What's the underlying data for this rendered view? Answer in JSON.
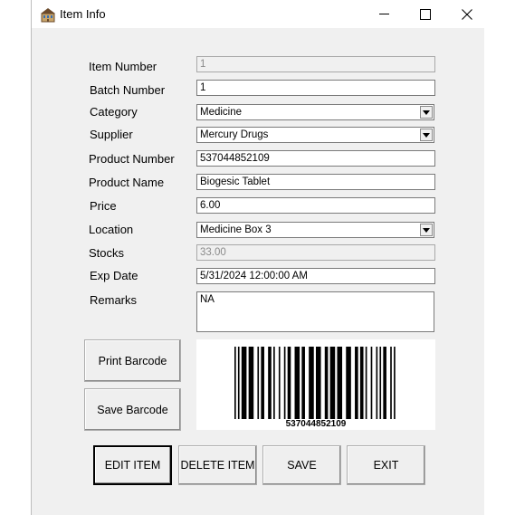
{
  "window": {
    "title": "Item Info",
    "icon": "building-icon"
  },
  "form": {
    "item_number": {
      "label": "Item Number",
      "value": "1",
      "readonly": true
    },
    "batch_number": {
      "label": "Batch Number",
      "value": "1"
    },
    "category": {
      "label": "Category",
      "value": "Medicine"
    },
    "supplier": {
      "label": "Supplier",
      "value": "Mercury Drugs"
    },
    "product_number": {
      "label": "Product Number",
      "value": "537044852109"
    },
    "product_name": {
      "label": "Product Name",
      "value": "Biogesic Tablet"
    },
    "price": {
      "label": "Price",
      "value": "6.00"
    },
    "location": {
      "label": "Location",
      "value": "Medicine Box 3"
    },
    "stocks": {
      "label": "Stocks",
      "value": "33.00",
      "readonly": true
    },
    "exp_date": {
      "label": "Exp Date",
      "value": "5/31/2024 12:00:00 AM"
    },
    "remarks": {
      "label": "Remarks",
      "value": "NA"
    }
  },
  "barcode": {
    "text": "537044852109",
    "print_label": "Print Barcode",
    "save_label": "Save Barcode"
  },
  "actions": {
    "edit_label": "EDIT ITEM",
    "delete_label": "DELETE ITEM",
    "save_label": "SAVE",
    "exit_label": "EXIT"
  }
}
